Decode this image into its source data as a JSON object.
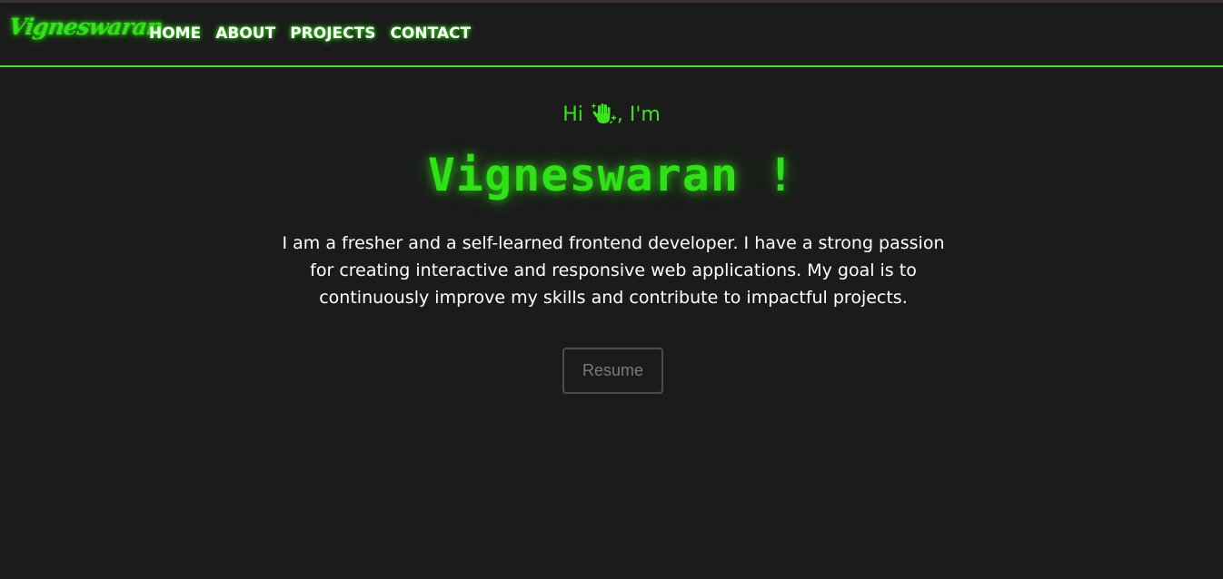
{
  "nav": {
    "brand": "Vigneswaran",
    "links": [
      "HOME",
      "ABOUT",
      "PROJECTS",
      "CONTACT"
    ]
  },
  "hero": {
    "greeting_prefix": "Hi",
    "greeting_suffix": ", I'm",
    "greeting_icon": "waving-hand-icon",
    "name": "Vigneswaran !",
    "intro": "I am a fresher and a self-learned frontend developer. I have a strong passion for creating interactive and responsive web applications. My goal is to continuously improve my skills and contribute to impactful projects.",
    "resume_label": "Resume"
  },
  "colors": {
    "background": "#1b1b1b",
    "accent": "#39e61a",
    "text": "#ffffff",
    "button_text": "#7a7a7a",
    "button_border": "#4d4d4d"
  }
}
